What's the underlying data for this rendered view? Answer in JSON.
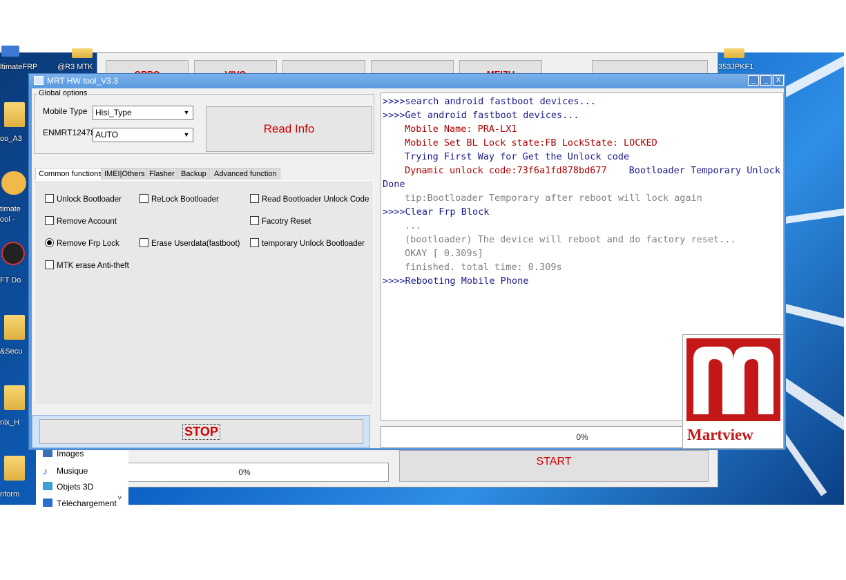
{
  "desktop": {
    "labels": {
      "l1": "ltimateFRP",
      "l2": "@R3 MTK",
      "l3": "353JPKF1",
      "l4": "oo_A3",
      "l5": "timate",
      "l6": "ool -",
      "l7": "FT Do",
      "l8": "&Secu",
      "l9": "nix_H",
      "l10": "nform"
    }
  },
  "bgwindow": {
    "topbuttons": [
      "OPPO",
      "VIVO",
      "",
      "",
      "MEIZU",
      ""
    ],
    "progress": "0%",
    "start_label": "START",
    "explorer_items": [
      "Images",
      "Musique",
      "Objets 3D",
      "Téléchargement"
    ]
  },
  "window": {
    "title": "MRT HW tool_V3.3",
    "min": "_",
    "max": "_",
    "close": "X"
  },
  "global": {
    "legend": "Global options",
    "mobile_type_label": "Mobile Type",
    "mobile_type_value": "Hisi_Type",
    "port_label": "ENMRT12478",
    "port_value": "AUTO",
    "read_info": "Read Info"
  },
  "tabs": [
    "Common functions",
    "IMEI|Others",
    "Flasher",
    "Backup",
    "Advanced function"
  ],
  "options": {
    "unlock_bootloader": "Unlock Bootloader",
    "relock_bootloader": "ReLock Bootloader",
    "read_unlock_code": "Read Bootloader Unlock Code",
    "remove_account": "Remove Account",
    "factory_reset": "Facotry Reset",
    "remove_frp": "Remove Frp Lock",
    "erase_userdata": "Erase Userdata(fastboot)",
    "temp_unlock": "temporary Unlock Bootloader",
    "mtk_erase": "MTK erase Anti-theft"
  },
  "stop_label": "STOP",
  "log": {
    "l1": ">>>>search android fastboot devices...",
    "l2": ">>>>Get android fastboot devices...",
    "l3": "Mobile Name: PRA-LX1",
    "l4": "Mobile Set BL Lock state:FB LockState: LOCKED",
    "l5": "Trying First Way for Get the Unlock code",
    "l6": "Dynamic unlock code:73f6a1fd878bd677",
    "l6b": "Bootloader Temporary  Unlock",
    "l7": "Done",
    "l8": "tip:Bootloader Temporary after reboot will lock again",
    "l9": ">>>>Clear Frp Block",
    "l10": "...",
    "l11": "(bootloader) The device will reboot and do factory reset...",
    "l12": "OKAY [  0.309s]",
    "l13": "finished. total time: 0.309s",
    "l14": ">>>>Rebooting Mobile Phone"
  },
  "progress": "0%",
  "logo_text": "Martview"
}
